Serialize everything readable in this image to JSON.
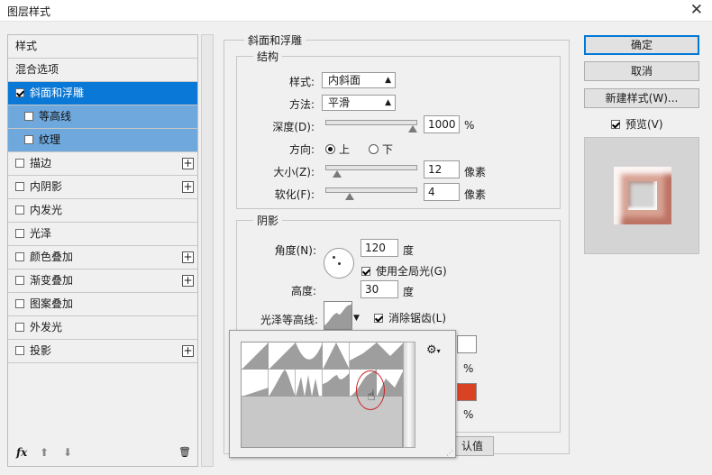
{
  "window": {
    "title": "图层样式",
    "close_glyph": "✕"
  },
  "sidebar": {
    "items": [
      {
        "label": "样式",
        "checkbox": false,
        "plus": false,
        "state": "normal"
      },
      {
        "label": "混合选项",
        "checkbox": false,
        "plus": false,
        "state": "normal"
      },
      {
        "label": "斜面和浮雕",
        "checkbox": true,
        "checked": true,
        "plus": false,
        "state": "selected"
      },
      {
        "label": "等高线",
        "checkbox": true,
        "checked": false,
        "plus": false,
        "state": "sub"
      },
      {
        "label": "纹理",
        "checkbox": true,
        "checked": false,
        "plus": false,
        "state": "sub"
      },
      {
        "label": "描边",
        "checkbox": true,
        "checked": false,
        "plus": true,
        "state": "normal"
      },
      {
        "label": "内阴影",
        "checkbox": true,
        "checked": false,
        "plus": true,
        "state": "normal"
      },
      {
        "label": "内发光",
        "checkbox": true,
        "checked": false,
        "plus": false,
        "state": "normal"
      },
      {
        "label": "光泽",
        "checkbox": true,
        "checked": false,
        "plus": false,
        "state": "normal"
      },
      {
        "label": "颜色叠加",
        "checkbox": true,
        "checked": false,
        "plus": true,
        "state": "normal"
      },
      {
        "label": "渐变叠加",
        "checkbox": true,
        "checked": false,
        "plus": true,
        "state": "normal"
      },
      {
        "label": "图案叠加",
        "checkbox": true,
        "checked": false,
        "plus": false,
        "state": "normal"
      },
      {
        "label": "外发光",
        "checkbox": true,
        "checked": false,
        "plus": false,
        "state": "normal"
      },
      {
        "label": "投影",
        "checkbox": true,
        "checked": false,
        "plus": true,
        "state": "normal"
      }
    ],
    "plus_glyph": "+",
    "bottom": {
      "fx": "fx",
      "up_glyph": "⬆",
      "down_glyph": "⬇",
      "trash_glyph": "🗑"
    }
  },
  "bevel": {
    "section_title": "斜面和浮雕",
    "structure": {
      "title": "结构",
      "style_label": "样式:",
      "style_value": "内斜面",
      "method_label": "方法:",
      "method_value": "平滑",
      "depth_label": "深度(D):",
      "depth_value": "1000",
      "depth_unit": "%",
      "depth_level": 1.0,
      "direction_label": "方向:",
      "direction_up": "上",
      "direction_down": "下",
      "size_label": "大小(Z):",
      "size_value": "12",
      "size_unit": "像素",
      "soften_label": "软化(F):",
      "soften_value": "4",
      "soften_unit": "像素"
    },
    "shading": {
      "title": "阴影",
      "angle_label": "角度(N):",
      "angle_value": "120",
      "angle_unit": "度",
      "global_light_label": "使用全局光(G)",
      "altitude_label": "高度:",
      "altitude_value": "30",
      "altitude_unit": "度",
      "gloss_label": "光泽等高线:",
      "antialias_label": "消除锯齿(L)",
      "percent_1": "%",
      "percent_2": "%",
      "reset_label": "认值"
    }
  },
  "buttons": {
    "ok": "确定",
    "cancel": "取消",
    "new_style": "新建样式(W)...",
    "preview_label": "预览(V)"
  },
  "picker": {
    "gear_glyph": "⚙",
    "gear_arrow": "▾"
  },
  "colors": {
    "accent": "#0a78d7",
    "sub_selected": "#6ea8dd",
    "shadow_color": "#d94323",
    "preview_pink": "#d9a394",
    "highlight_ring": "#cc2222"
  }
}
